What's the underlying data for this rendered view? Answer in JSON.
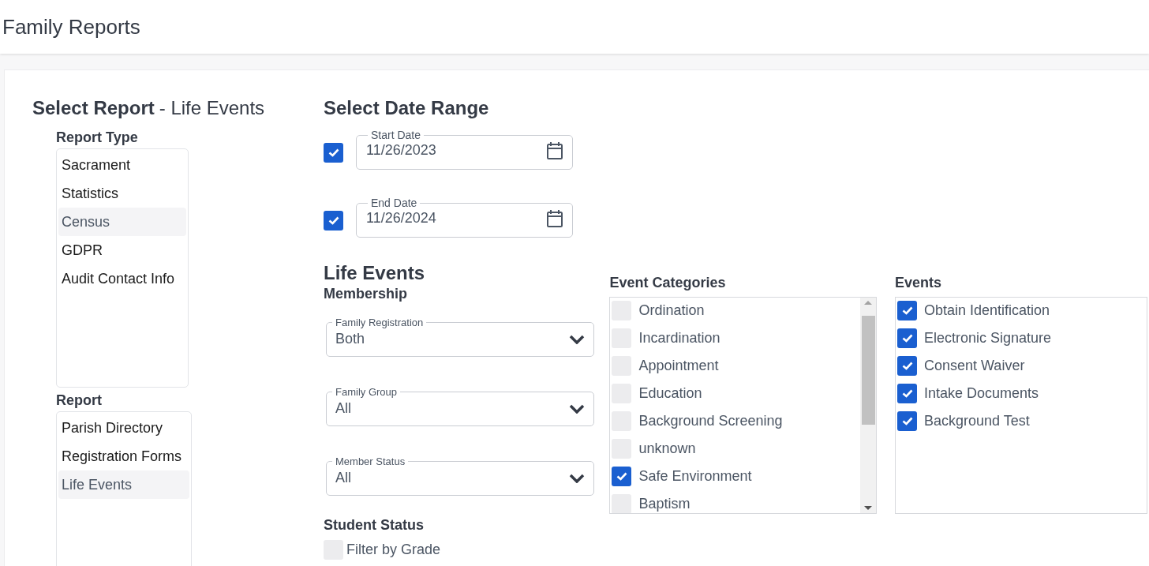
{
  "page_title": "Family Reports",
  "select_report": {
    "heading": "Select Report",
    "current": "- Life Events"
  },
  "report_type": {
    "label": "Report Type",
    "items": [
      {
        "label": "Sacrament",
        "selected": false
      },
      {
        "label": "Statistics",
        "selected": false
      },
      {
        "label": "Census",
        "selected": true
      },
      {
        "label": "GDPR",
        "selected": false
      },
      {
        "label": "Audit Contact Info",
        "selected": false
      }
    ]
  },
  "report": {
    "label": "Report",
    "items": [
      {
        "label": "Parish Directory",
        "selected": false
      },
      {
        "label": "Registration Forms",
        "selected": false
      },
      {
        "label": "Life Events",
        "selected": true
      }
    ]
  },
  "date_range": {
    "heading": "Select Date Range",
    "fields": [
      {
        "label": "Start Date",
        "value": "11/26/2023",
        "checked": true
      },
      {
        "label": "End Date",
        "value": "11/26/2024",
        "checked": true
      }
    ]
  },
  "life_events": {
    "heading": "Life Events",
    "membership_label": "Membership",
    "selects": [
      {
        "label": "Family Registration",
        "value": "Both"
      },
      {
        "label": "Family Group",
        "value": "All"
      },
      {
        "label": "Member Status",
        "value": "All"
      }
    ],
    "student_status": {
      "label": "Student Status",
      "option": {
        "label": "Filter by Grade",
        "checked": false
      }
    }
  },
  "event_categories": {
    "label": "Event Categories",
    "items": [
      {
        "label": "Ordination",
        "checked": false
      },
      {
        "label": "Incardination",
        "checked": false
      },
      {
        "label": "Appointment",
        "checked": false
      },
      {
        "label": "Education",
        "checked": false
      },
      {
        "label": "Background Screening",
        "checked": false
      },
      {
        "label": "unknown",
        "checked": false
      },
      {
        "label": "Safe Environment",
        "checked": true
      },
      {
        "label": "Baptism",
        "checked": false
      }
    ]
  },
  "events": {
    "label": "Events",
    "items": [
      {
        "label": "Obtain Identification",
        "checked": true
      },
      {
        "label": "Electronic Signature",
        "checked": true
      },
      {
        "label": "Consent Waiver",
        "checked": true
      },
      {
        "label": "Intake Documents",
        "checked": true
      },
      {
        "label": "Background Test",
        "checked": true
      }
    ]
  }
}
